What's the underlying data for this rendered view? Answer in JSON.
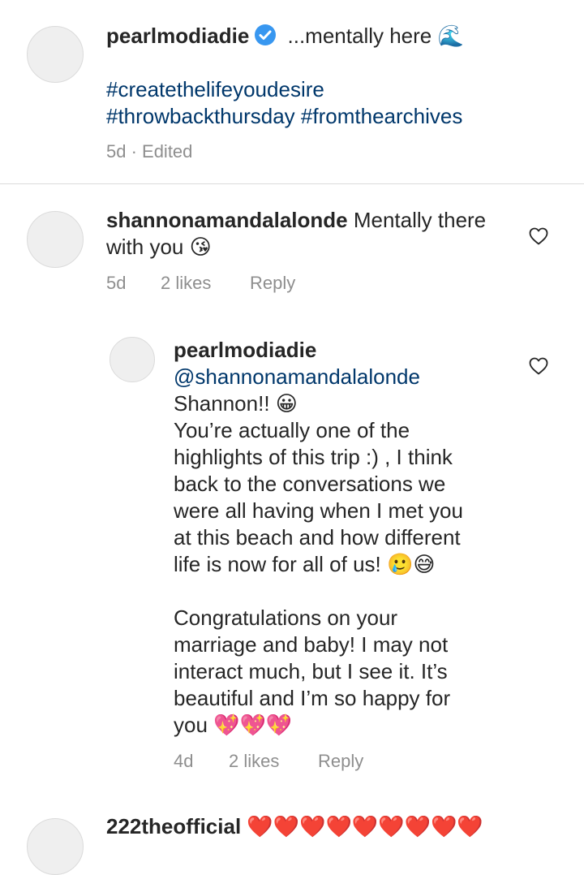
{
  "caption": {
    "username": "pearlmodiadie",
    "text": "...mentally here 🌊",
    "hashtag_line1": "#createthelifeyoudesire",
    "hashtag_line2a": "#throwbackthursday",
    "hashtag_line2b": "#fromthearchives",
    "meta": "5d · Edited"
  },
  "comment1": {
    "username": "shannonamandalalonde",
    "text_line1": "Mentally there",
    "text_line2": "with you 😘",
    "time": "5d",
    "likes": "2 likes",
    "reply": "Reply"
  },
  "reply1": {
    "username": "pearlmodiadie",
    "lines": [
      "@shannonamandalalonde",
      "Shannon!! 😀",
      "You’re actually one of the",
      "highlights of this trip :) , I think",
      "back to the conversations we",
      "were all having when I met you",
      "at this beach and how different",
      "life is now for all of us! 🥲😅",
      "",
      "Congratulations on your",
      "marriage and baby! I may not",
      "interact much, but I see it. It’s",
      "beautiful and I’m so happy for",
      "you 💖💖💖"
    ],
    "time": "4d",
    "likes": "2 likes",
    "reply": "Reply"
  },
  "comment2": {
    "username": "222theofficial",
    "hearts": "❤️❤️❤️❤️❤️❤️❤️❤️❤️"
  },
  "colors": {
    "text": "#262626",
    "meta": "#8e8e8e",
    "hashtag": "#00376b",
    "verified": "#3897f0",
    "heart_red": "#ed4956"
  }
}
